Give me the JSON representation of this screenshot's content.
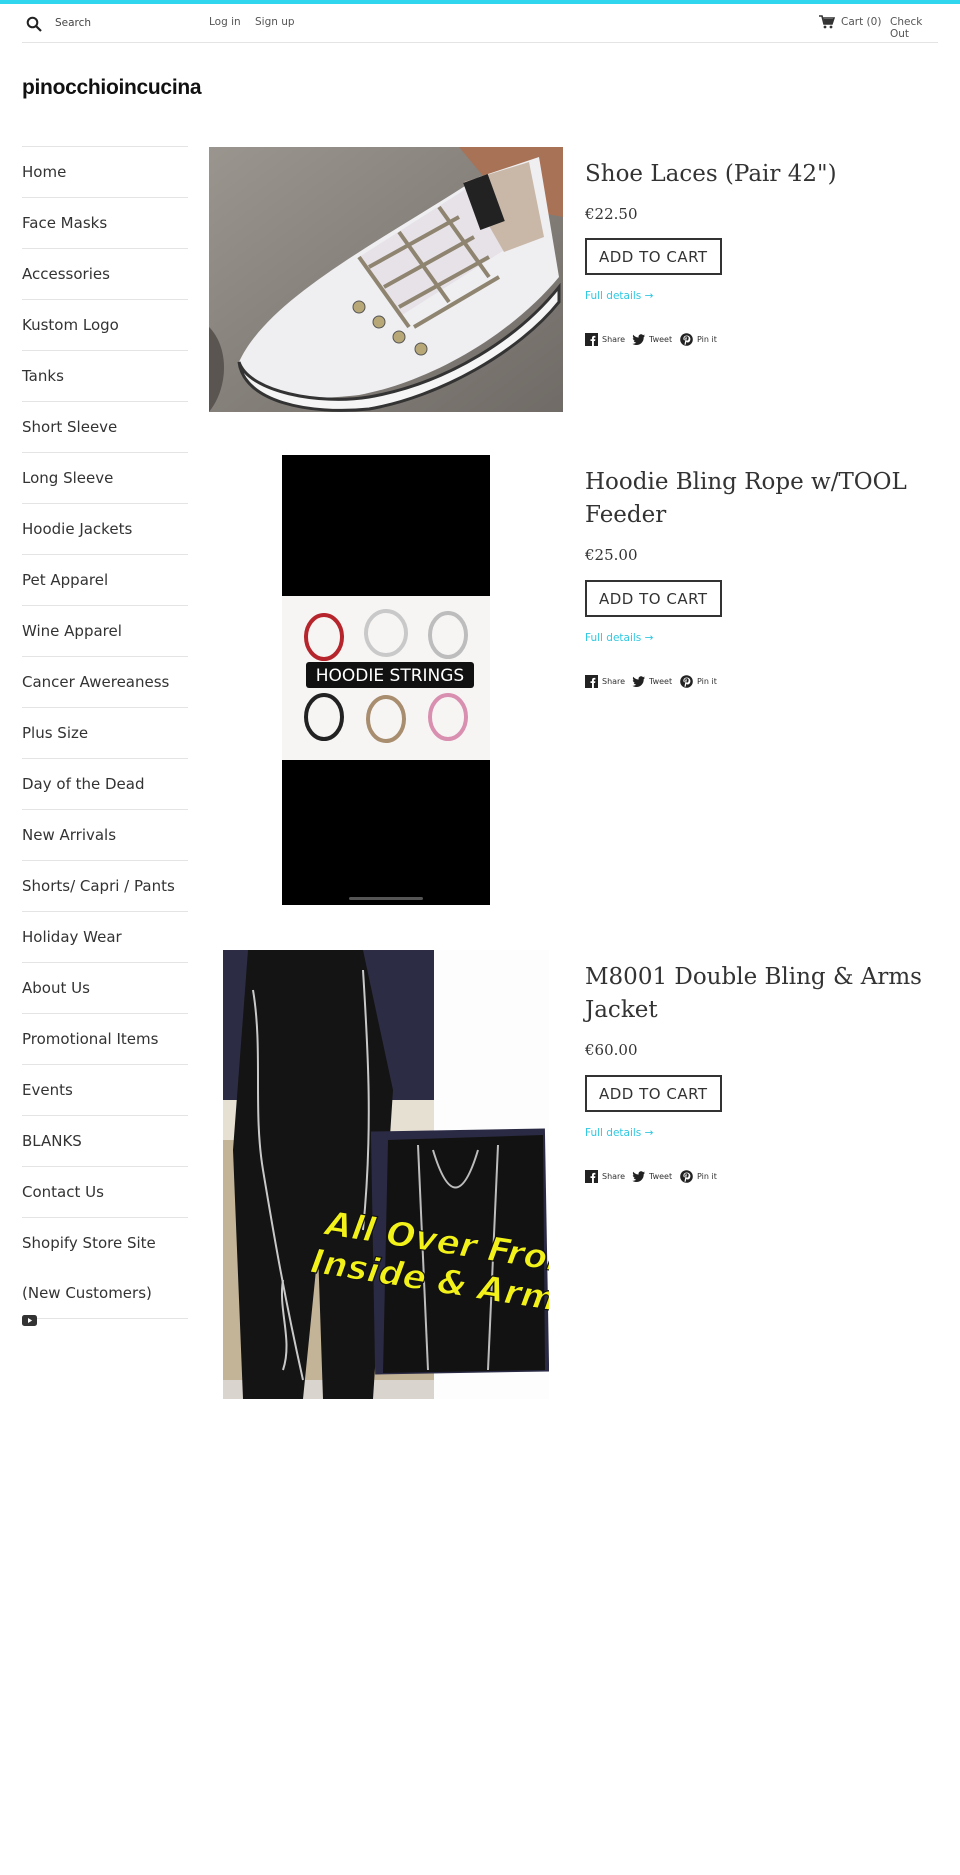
{
  "header": {
    "search_placeholder": "Search",
    "login": "Log in",
    "signup": "Sign up",
    "cart": "Cart (0)",
    "checkout": "Check Out"
  },
  "store": {
    "name": "pinocchioincucina"
  },
  "sidebar": {
    "items": [
      "Home",
      "Face Masks",
      "Accessories",
      "Kustom Logo",
      "Tanks",
      "Short Sleeve",
      "Long Sleeve",
      "Hoodie Jackets",
      "Pet Apparel",
      "Wine Apparel",
      "Cancer Awereaness",
      "Plus Size",
      "Day of the Dead",
      "New Arrivals",
      "Shorts/ Capri / Pants",
      "Holiday Wear",
      "About Us",
      "Promotional Items",
      "Events",
      "BLANKS",
      "Contact Us"
    ],
    "last_item_line1": "Shopify Store Site",
    "last_item_line2": "(New Customers)",
    "social_icon": "youtube-icon"
  },
  "products": [
    {
      "title": "Shoe Laces (Pair 42\")",
      "price": "€22.50",
      "add_to_cart": "ADD TO CART",
      "details": "Full details →"
    },
    {
      "title": "Hoodie Bling Rope w/TOOL Feeder",
      "price": "€25.00",
      "add_to_cart": "ADD TO CART",
      "details": "Full details →",
      "image_text": "HOODIE STRINGS"
    },
    {
      "title": "M8001 Double Bling & Arms Jacket",
      "price": "€60.00",
      "add_to_cart": "ADD TO CART",
      "details": "Full details →",
      "image_text_line1": "All Over Front",
      "image_text_line2": "Inside & Arms"
    }
  ],
  "social": {
    "share": "Share",
    "tweet": "Tweet",
    "pin": "Pin it"
  },
  "colors": {
    "accent": "#30d5ee",
    "link": "#30c8e0",
    "text": "#333333"
  }
}
